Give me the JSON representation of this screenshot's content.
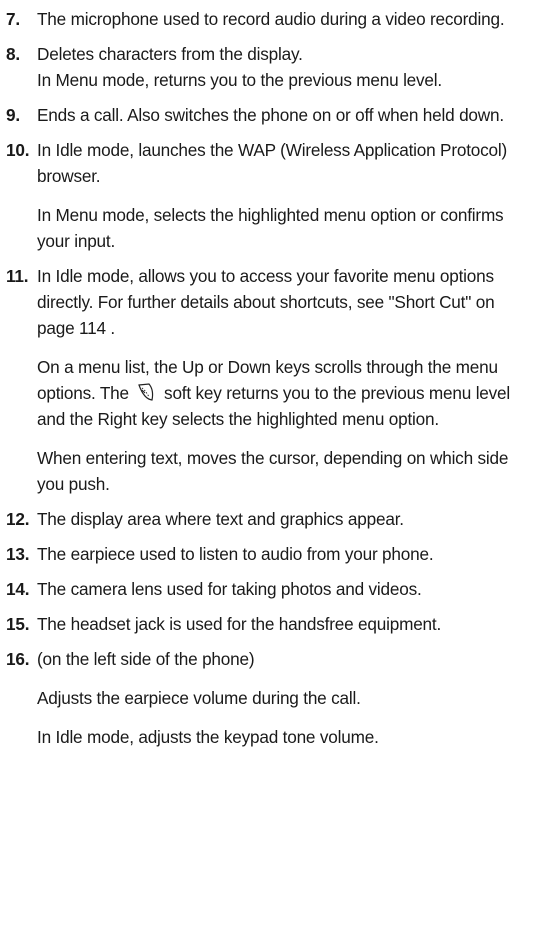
{
  "items": [
    {
      "number": "7.",
      "paragraphs": [
        "The microphone used to record audio during a video recording."
      ]
    },
    {
      "number": "8.",
      "paragraphs": [
        "Deletes characters from the display.",
        "In Menu mode, returns you to the previous menu level."
      ]
    },
    {
      "number": "9.",
      "paragraphs": [
        "Ends a call. Also switches the phone on or off when held down."
      ]
    },
    {
      "number": "10.",
      "paragraphs": [
        "In Idle mode, launches the WAP (Wireless Application Protocol) browser.",
        "In Menu mode, selects the highlighted menu option or confirms your input."
      ]
    },
    {
      "number": "11.",
      "paragraphs": [
        "In Idle mode, allows you to access your favorite menu options directly. For further details about shortcuts, see \"Short Cut\" on page 114 .",
        {
          "before": "On a menu list, the Up or Down keys scrolls through the menu options. The",
          "icon": "soft-key-icon",
          "after": "soft key returns you to the previous menu level and the Right key selects the highlighted menu option."
        },
        "When entering text, moves the cursor, depending on which side you push."
      ]
    },
    {
      "number": "12.",
      "paragraphs": [
        "The display area where text and graphics appear."
      ]
    },
    {
      "number": "13.",
      "paragraphs": [
        "The earpiece used to listen to audio from your phone."
      ]
    },
    {
      "number": "14.",
      "paragraphs": [
        "The camera lens used for taking photos and videos."
      ]
    },
    {
      "number": "15.",
      "paragraphs": [
        "The headset jack is used for the handsfree equipment."
      ]
    },
    {
      "number": "16.",
      "paragraphs": [
        "(on the left side of the phone)",
        "Adjusts the earpiece volume during the call.",
        "In Idle mode, adjusts the keypad tone volume."
      ]
    }
  ]
}
